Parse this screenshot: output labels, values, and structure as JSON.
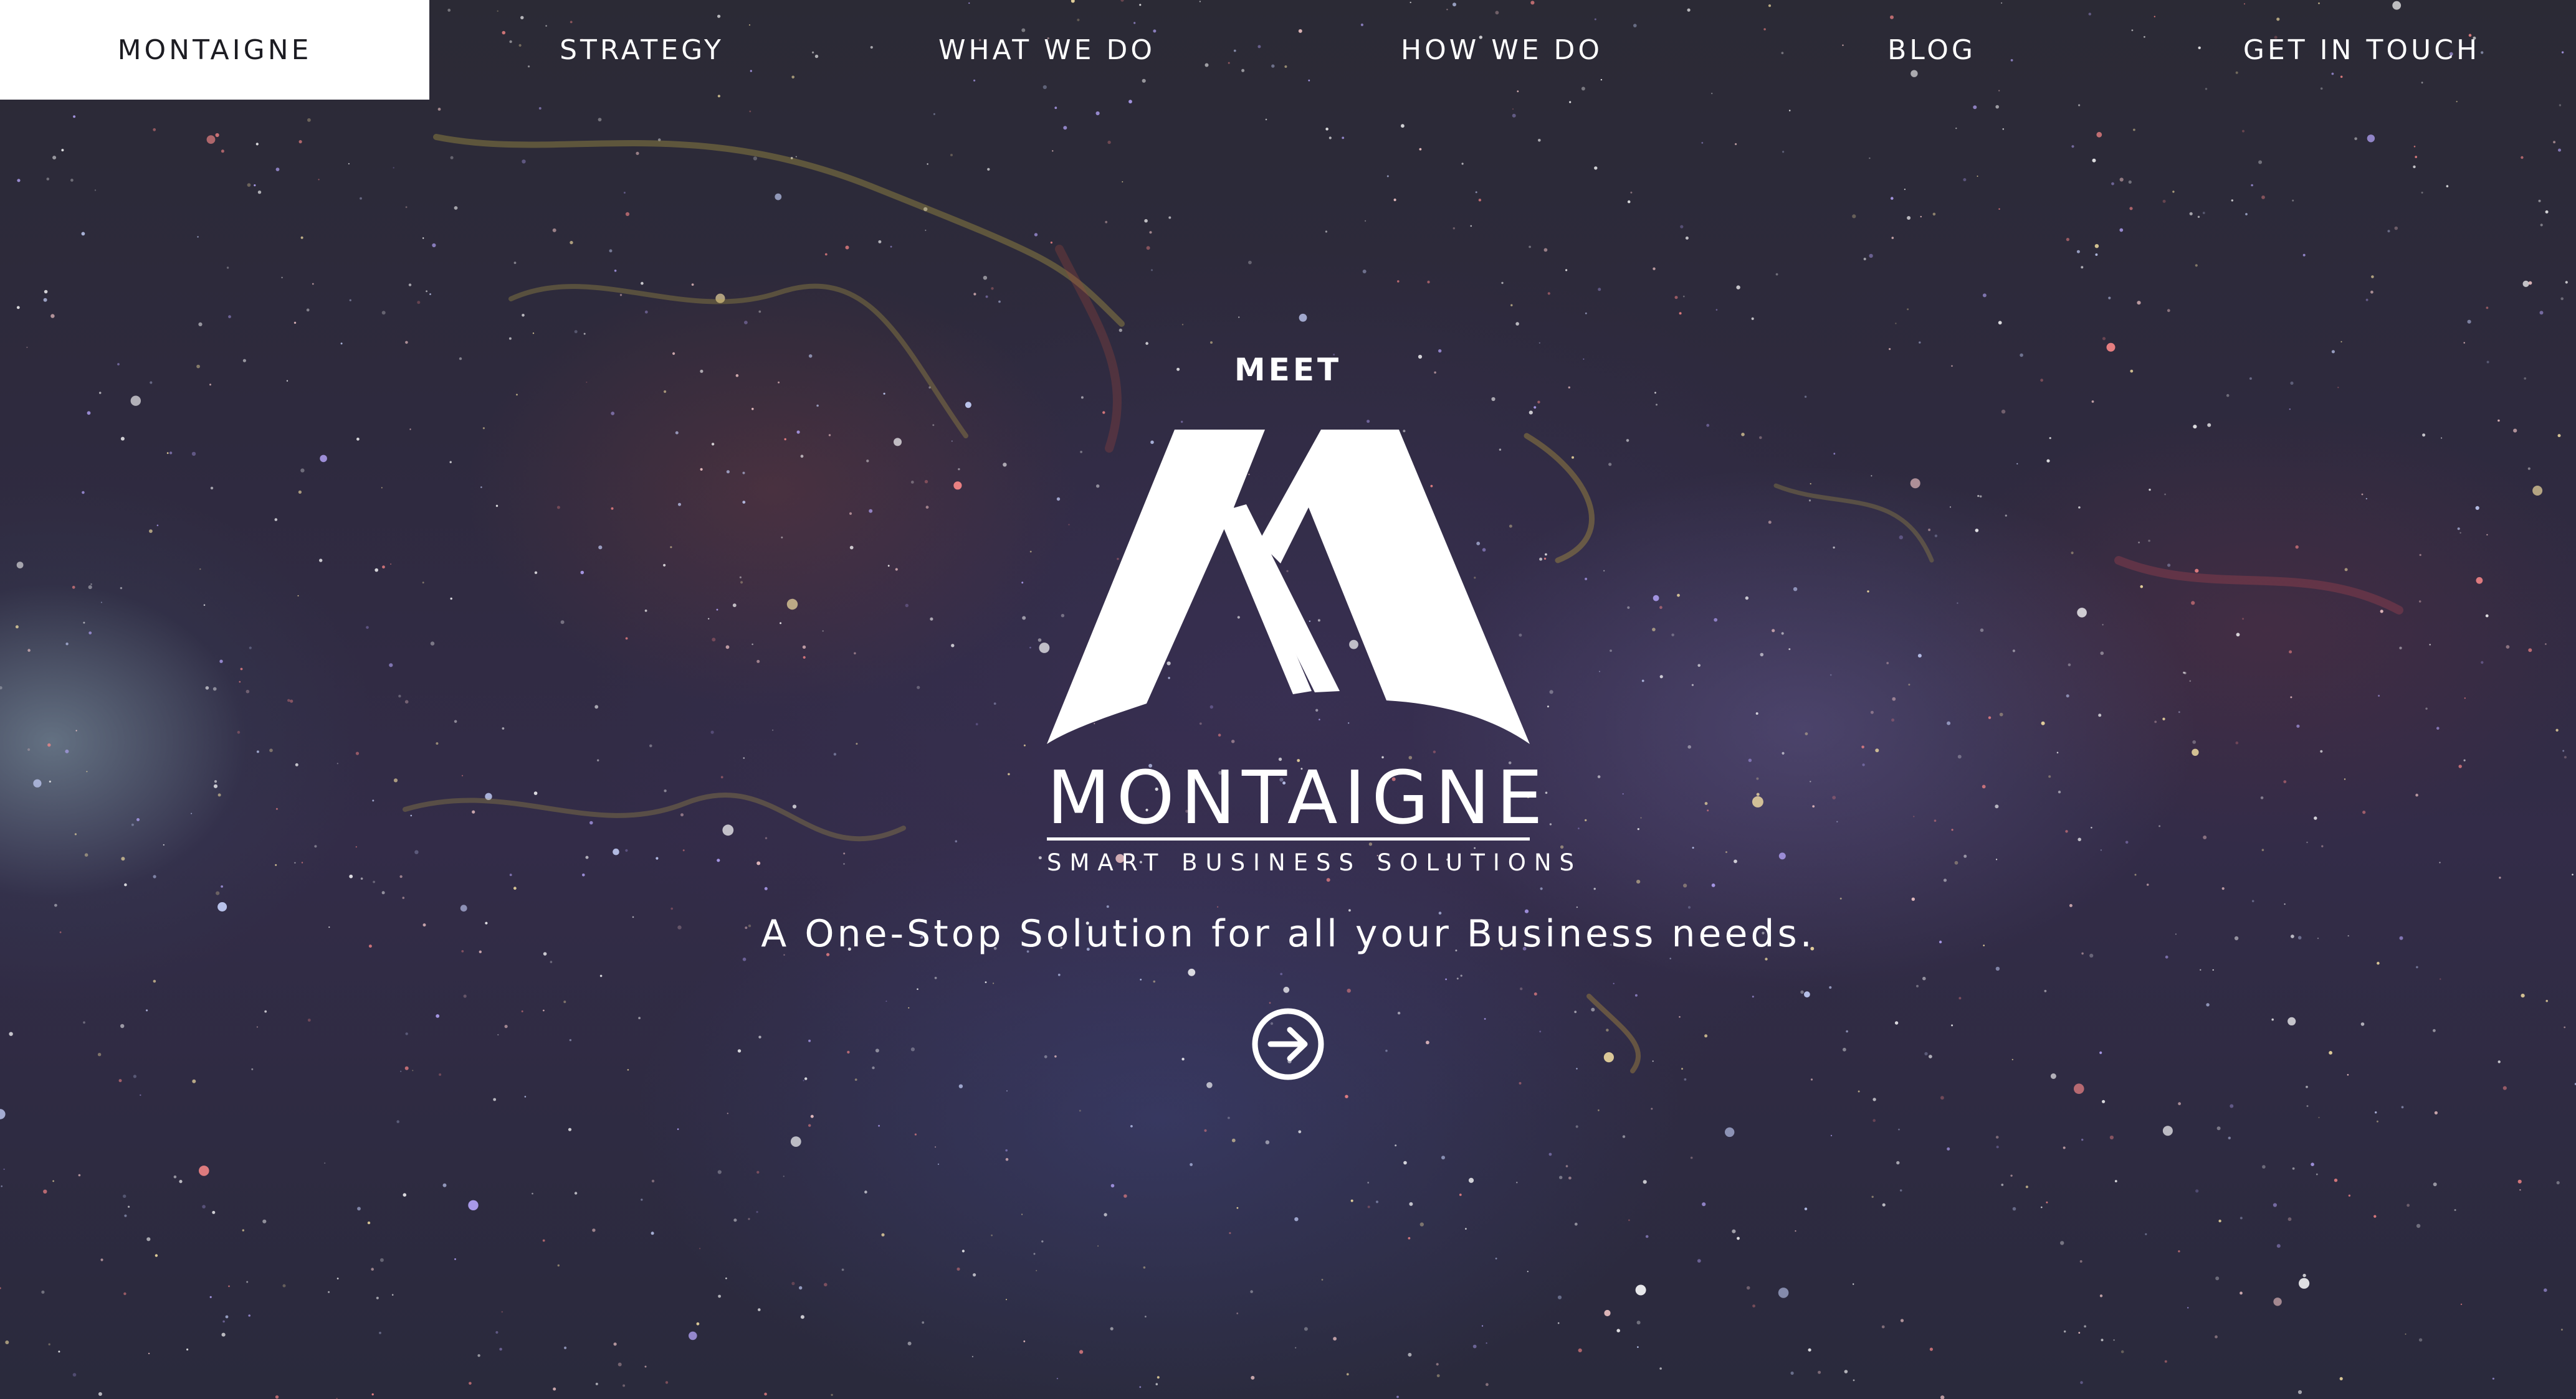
{
  "nav": {
    "items": [
      {
        "label": "MONTAIGNE",
        "active": true
      },
      {
        "label": "STRATEGY",
        "active": false
      },
      {
        "label": "WHAT WE DO",
        "active": false
      },
      {
        "label": "HOW WE DO",
        "active": false
      },
      {
        "label": "BLOG",
        "active": false
      },
      {
        "label": "GET IN TOUCH",
        "active": false
      }
    ]
  },
  "hero": {
    "kicker": "MEET",
    "brand_name": "MONTAIGNE",
    "brand_tagline": "SMART BUSINESS SOLUTIONS",
    "headline": "A One-Stop Solution for all your Business needs.",
    "cta_icon": "arrow-right-circle-icon"
  },
  "colors": {
    "background": "#2b2a35",
    "text": "#ffffff",
    "active_nav_bg": "#ffffff",
    "active_nav_text": "#1c1c22"
  }
}
